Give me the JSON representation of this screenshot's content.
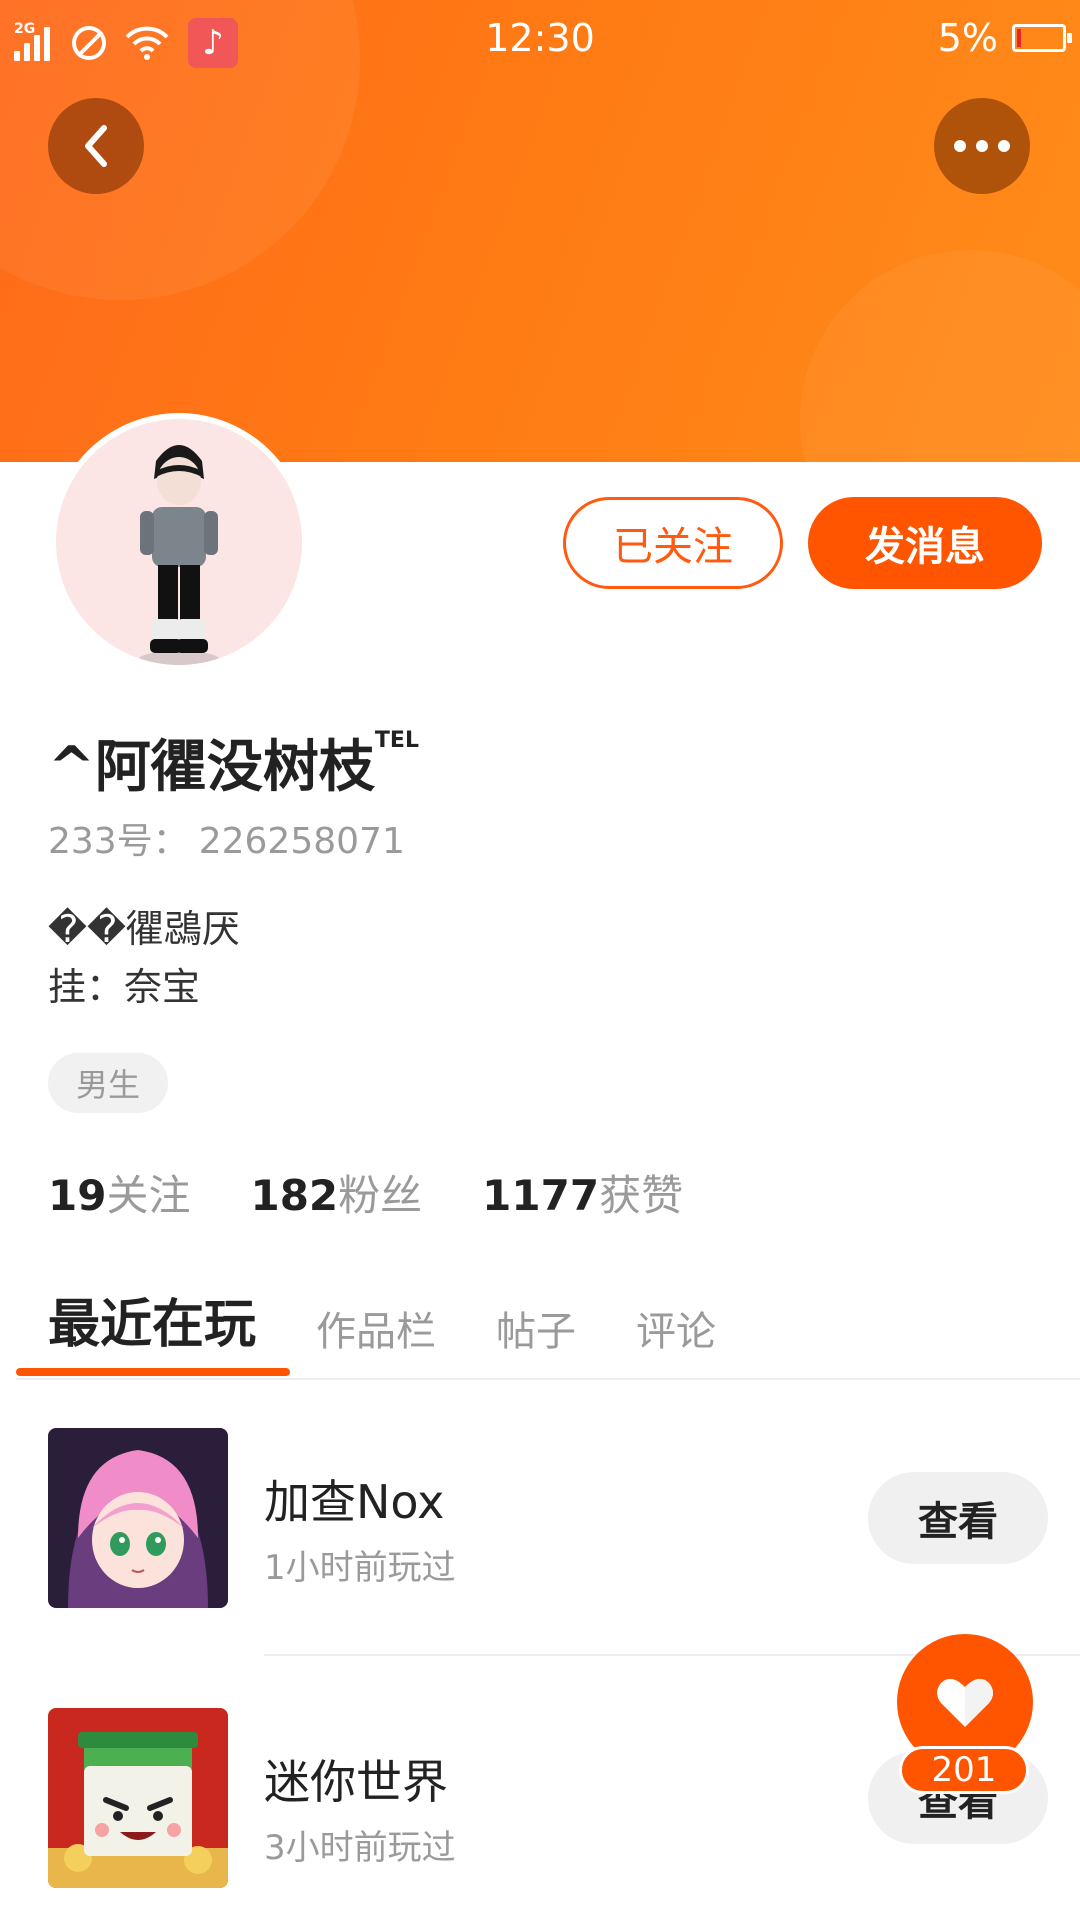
{
  "status_bar": {
    "network": "2G",
    "time": "12:30",
    "battery": "5%"
  },
  "profile": {
    "name": "^阿忂没树枝",
    "name_suffix": "TEL",
    "uid_label": "233号：",
    "uid_value": "226258071",
    "bio_line1": "��忂鵋厌",
    "bio_line2": "挂：奈宝",
    "gender_tag": "男生"
  },
  "actions": {
    "follow_label": "已关注",
    "message_label": "发消息"
  },
  "stats": [
    {
      "value": "19",
      "label": "关注"
    },
    {
      "value": "182",
      "label": "粉丝"
    },
    {
      "value": "1177",
      "label": "获赞"
    }
  ],
  "tabs": [
    {
      "label": "最近在玩",
      "active": true
    },
    {
      "label": "作品栏",
      "active": false
    },
    {
      "label": "帖子",
      "active": false
    },
    {
      "label": "评论",
      "active": false
    }
  ],
  "games": [
    {
      "title": "加查Nox",
      "sub": "1小时前玩过",
      "button": "查看"
    },
    {
      "title": "迷你世界",
      "sub": "3小时前玩过",
      "button": "查看"
    }
  ],
  "like": {
    "count": "201"
  },
  "colors": {
    "accent": "#ff5500",
    "header": "#ff7a14"
  }
}
